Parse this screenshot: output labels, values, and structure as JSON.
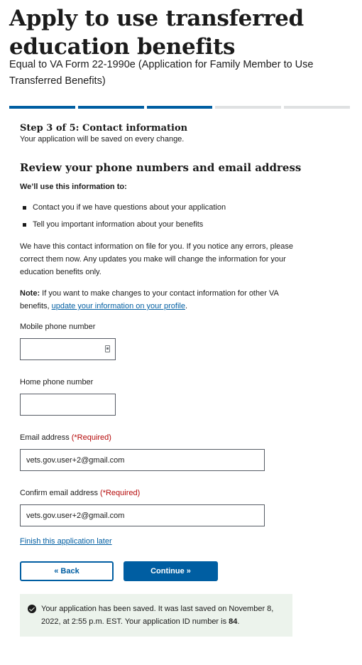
{
  "header": {
    "title": "Apply to use transferred education benefits",
    "subtitle": "Equal to VA Form 22-1990e (Application for Family Member to Use Transferred Benefits)"
  },
  "progress": {
    "current_step": 3,
    "total_steps": 5
  },
  "step": {
    "title": "Step 3 of 5: Contact information",
    "note": "Your application will be saved on every change."
  },
  "section": {
    "title": "Review your phone numbers and email address",
    "intro": "We’ll use this information to:",
    "bullets": [
      "Contact you if we have questions about your application",
      "Tell you important information about your benefits"
    ],
    "paragraph": "We have this contact information on file for you. If you notice any errors, please correct them now. Any updates you make will change the information for your education benefits only.",
    "note_label": "Note:",
    "note_text": " If you want to make changes to your contact information for other VA benefits, ",
    "note_link": "update your information on your profile",
    "note_end": "."
  },
  "form": {
    "mobile_label": "Mobile phone number",
    "mobile_value": "",
    "home_label": "Home phone number",
    "home_value": "",
    "email_label": "Email address",
    "email_value": "vets.gov.user+2@gmail.com",
    "confirm_label": "Confirm email address",
    "confirm_value": "vets.gov.user+2@gmail.com",
    "required_text": "(*Required)"
  },
  "actions": {
    "finish_later": "Finish this application later",
    "back": "« Back",
    "continue": "Continue »"
  },
  "alert": {
    "text": "Your application has been saved. It was last saved on November 8, 2022, at 2:55 p.m. EST. Your application ID number is ",
    "app_id": "84",
    "end": "."
  },
  "colors": {
    "primary": "#005ea2",
    "required": "#b50909",
    "success_bg": "#ecf3ec"
  }
}
